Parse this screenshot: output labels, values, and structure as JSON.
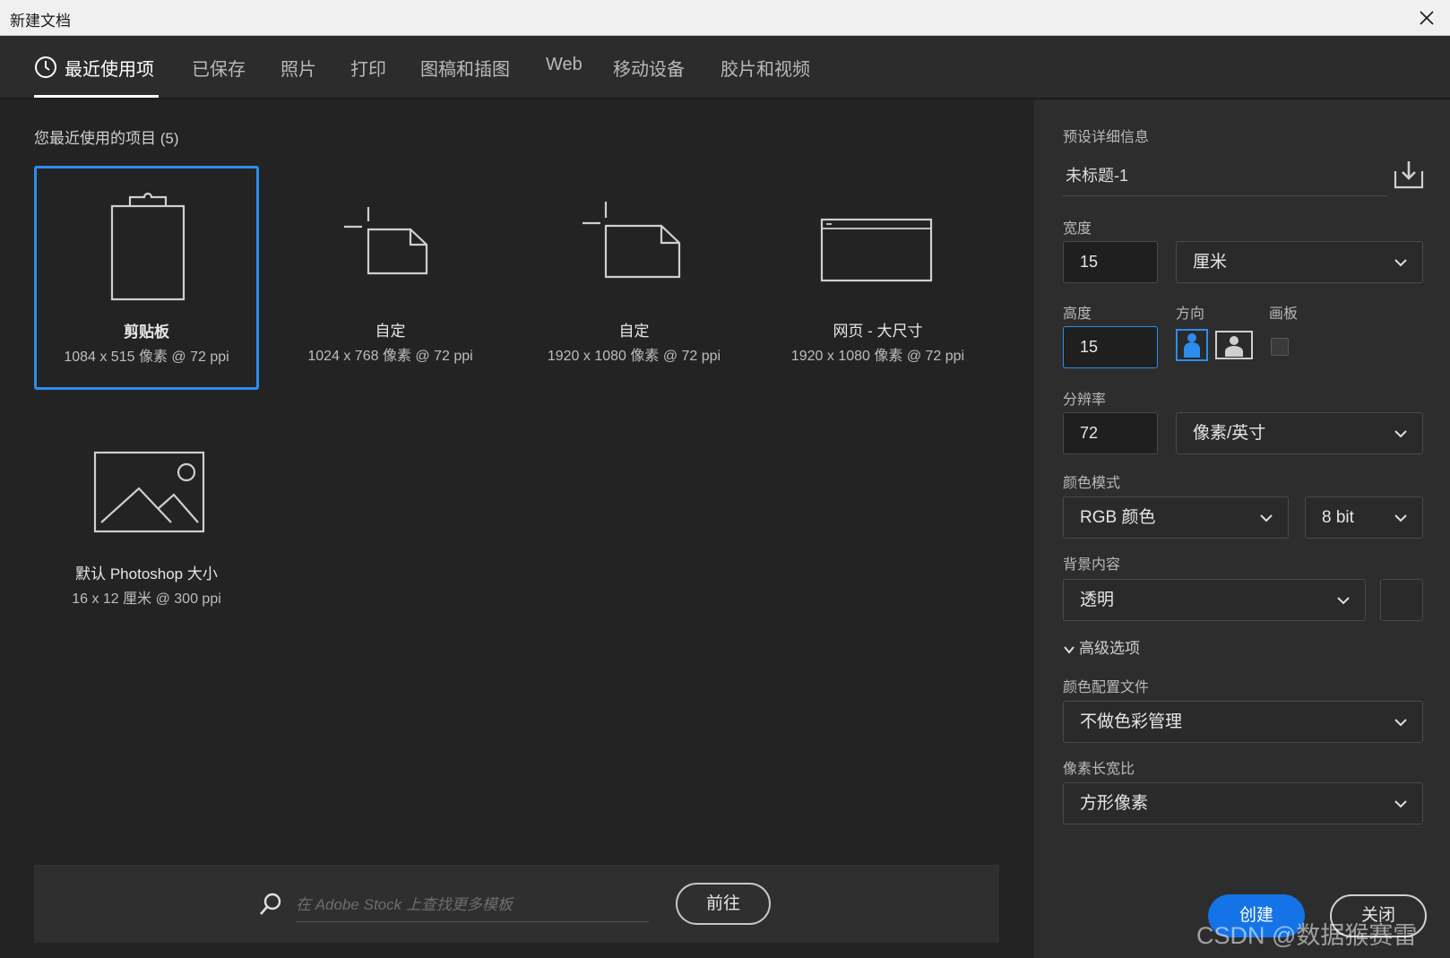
{
  "window": {
    "title": "新建文档"
  },
  "tabs": [
    {
      "label": "最近使用项",
      "active": true
    },
    {
      "label": "已保存"
    },
    {
      "label": "照片"
    },
    {
      "label": "打印"
    },
    {
      "label": "图稿和插图"
    },
    {
      "label": "Web"
    },
    {
      "label": "移动设备"
    },
    {
      "label": "胶片和视频"
    }
  ],
  "recent": {
    "title": "您最近使用的项目 (5)",
    "items": [
      {
        "name": "剪贴板",
        "size": "1084 x 515 像素 @ 72 ppi",
        "icon": "clipboard-icon",
        "selected": true
      },
      {
        "name": "自定",
        "size": "1024 x 768 像素 @ 72 ppi",
        "icon": "custom-document-icon"
      },
      {
        "name": "自定",
        "size": "1920 x 1080 像素 @ 72 ppi",
        "icon": "custom-document-icon"
      },
      {
        "name": "网页 - 大尺寸",
        "size": "1920 x 1080 像素 @ 72 ppi",
        "icon": "web-page-icon"
      },
      {
        "name": "默认 Photoshop 大小",
        "size": "16 x 12 厘米 @ 300 ppi",
        "icon": "image-icon"
      }
    ]
  },
  "stock": {
    "placeholder": "在 Adobe Stock 上查找更多模板",
    "go_label": "前往"
  },
  "preset": {
    "section_title": "预设详细信息",
    "name": "未标题-1",
    "width_label": "宽度",
    "width_value": "15",
    "width_unit": "厘米",
    "height_label": "高度",
    "height_value": "15",
    "orientation_label": "方向",
    "artboard_label": "画板",
    "resolution_label": "分辨率",
    "resolution_value": "72",
    "resolution_unit": "像素/英寸",
    "color_mode_label": "颜色模式",
    "color_mode": "RGB 颜色",
    "bit_depth": "8 bit",
    "background_label": "背景内容",
    "background": "透明",
    "advanced_label": "高级选项",
    "color_profile_label": "颜色配置文件",
    "color_profile": "不做色彩管理",
    "pixel_aspect_label": "像素长宽比",
    "pixel_aspect": "方形像素"
  },
  "actions": {
    "create": "创建",
    "close": "关闭"
  },
  "watermark": "CSDN @数据猴赛雷",
  "colors": {
    "accent": "#1473e6",
    "selection": "#2d8ceb",
    "background": "#232323",
    "panel": "#2d2d2d"
  }
}
